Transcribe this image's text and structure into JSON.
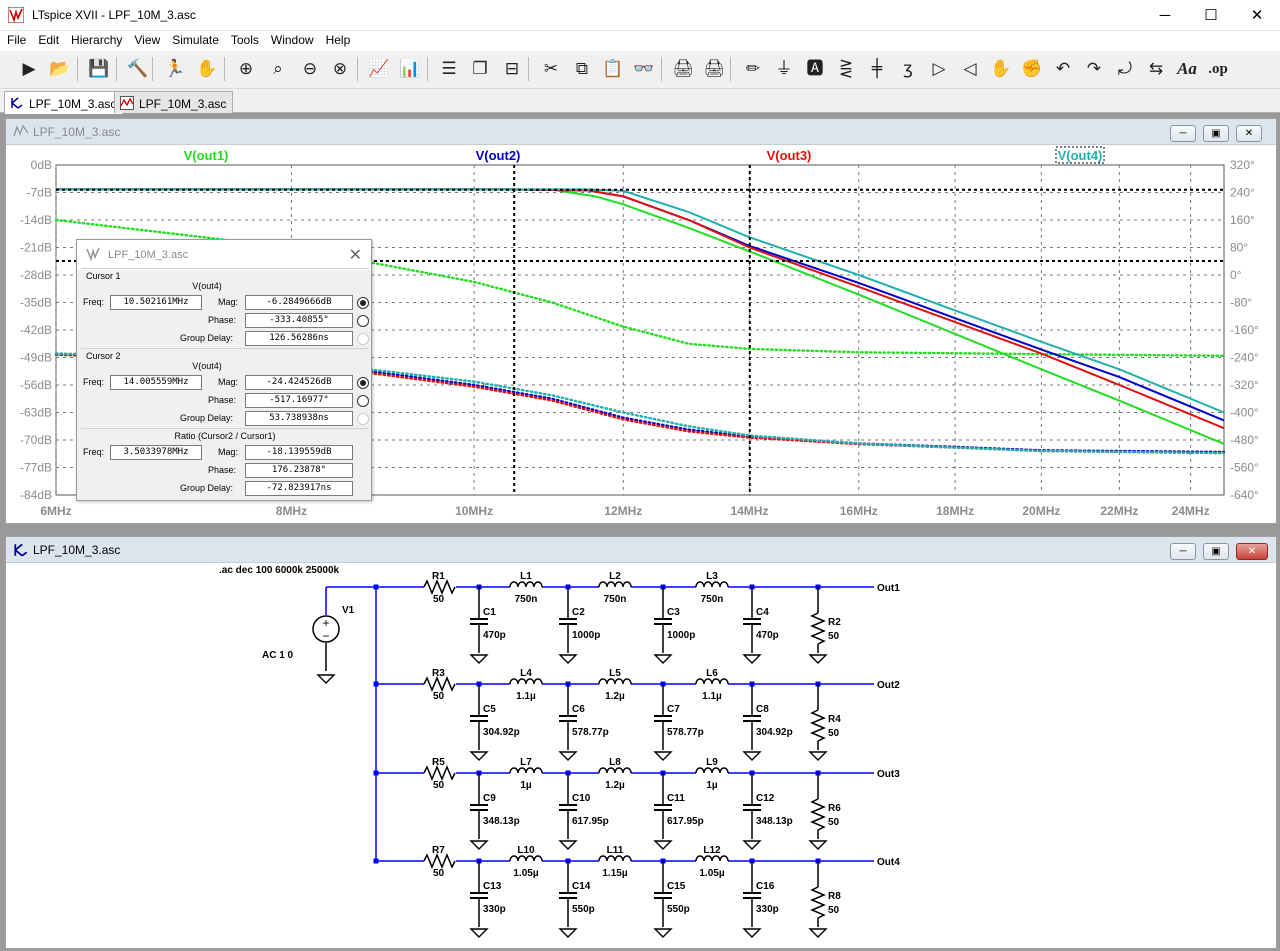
{
  "app": {
    "title": "LTspice XVII - LPF_10M_3.asc",
    "minimize": "─",
    "maximize": "☐",
    "close": "✕"
  },
  "menu": [
    "File",
    "Edit",
    "Hierarchy",
    "View",
    "Simulate",
    "Tools",
    "Window",
    "Help"
  ],
  "toolbar_icons": [
    "run-icon",
    "open-icon",
    "save-icon",
    "hammer-icon",
    "halt-icon",
    "pan-hand-icon",
    "zoom-in-icon",
    "zoom-full-icon",
    "zoom-out-icon",
    "zoom-cancel-icon",
    "autorange-icon",
    "plot-settings-icon",
    "tile-horizontal-icon",
    "cascade-icon",
    "tile-vertical-icon",
    "cut-icon",
    "copy-icon",
    "paste-icon",
    "find-icon",
    "print-preview-icon",
    "print-icon",
    "wire-icon",
    "ground-icon",
    "label-icon",
    "resistor-icon",
    "capacitor-icon",
    "inductor-icon",
    "diode-icon",
    "component-icon",
    "move-icon",
    "drag-icon",
    "undo-icon",
    "redo-icon",
    "rotate-icon",
    "mirror-icon",
    "text-icon",
    "spice-directive-icon"
  ],
  "toolbar_text": {
    "text_tool": "Aa",
    ".op": ".op"
  },
  "tabs": [
    {
      "label": "LPF_10M_3.asc"
    },
    {
      "label": "LPF_10M_3.asc"
    }
  ],
  "waveform_window": {
    "title": "LPF_10M_3.asc",
    "min": "─",
    "restore": "▣",
    "close": "✕"
  },
  "schematic_window": {
    "title": "LPF_10M_3.asc",
    "min": "─",
    "restore": "▣",
    "close": "✕"
  },
  "colors": {
    "out1": "#22dd22",
    "out2": "#0000cc",
    "out3": "#e01010",
    "out4": "#20b0b0",
    "grid": "#7a7a7a",
    "axis_text": "#8c8c8c",
    "wire": "#0000ff",
    "component": "#000000"
  },
  "chart_data": {
    "type": "line",
    "x_scale": "log",
    "xlim_mhz": [
      6,
      25
    ],
    "x_ticks": [
      "6MHz",
      "8MHz",
      "10MHz",
      "12MHz",
      "14MHz",
      "16MHz",
      "18MHz",
      "20MHz",
      "22MHz",
      "24MHz"
    ],
    "x_tick_values": [
      6,
      8,
      10,
      12,
      14,
      16,
      18,
      20,
      22,
      24
    ],
    "left_ticks": [
      "0dB",
      "-7dB",
      "-14dB",
      "-21dB",
      "-28dB",
      "-35dB",
      "-42dB",
      "-49dB",
      "-56dB",
      "-63dB",
      "-70dB",
      "-77dB",
      "-84dB"
    ],
    "ylim_db": [
      -84,
      0
    ],
    "right_ticks": [
      "320°",
      "240°",
      "160°",
      "80°",
      "0°",
      "-80°",
      "-160°",
      "-240°",
      "-320°",
      "-400°",
      "-480°",
      "-560°",
      "-640°"
    ],
    "ylim_deg": [
      -640,
      320
    ],
    "series": [
      {
        "name": "V(out1)",
        "key": "out1",
        "mag": [
          [
            6,
            -6.2
          ],
          [
            10,
            -6.2
          ],
          [
            11,
            -6.3
          ],
          [
            11.6,
            -8
          ],
          [
            12,
            -10
          ],
          [
            13,
            -16
          ],
          [
            14,
            -22
          ],
          [
            16,
            -33
          ],
          [
            18,
            -43
          ],
          [
            20,
            -52
          ],
          [
            22,
            -60
          ],
          [
            25,
            -71
          ]
        ],
        "phase": [
          [
            6,
            160
          ],
          [
            8,
            80
          ],
          [
            10,
            -20
          ],
          [
            11,
            -80
          ],
          [
            12,
            -150
          ],
          [
            13,
            -200
          ],
          [
            14,
            -215
          ],
          [
            16,
            -225
          ],
          [
            20,
            -230
          ],
          [
            25,
            -235
          ]
        ]
      },
      {
        "name": "V(out2)",
        "key": "out2",
        "mag": [
          [
            6,
            -6.2
          ],
          [
            10.5,
            -6.2
          ],
          [
            11.5,
            -6.5
          ],
          [
            12,
            -8
          ],
          [
            13,
            -14
          ],
          [
            14,
            -20.6
          ],
          [
            16,
            -30
          ],
          [
            18,
            -39
          ],
          [
            20,
            -47
          ],
          [
            22,
            -54
          ],
          [
            25,
            -65
          ]
        ],
        "phase": [
          [
            6,
            -230
          ],
          [
            8,
            -250
          ],
          [
            10,
            -320
          ],
          [
            11,
            -360
          ],
          [
            12,
            -415
          ],
          [
            13,
            -450
          ],
          [
            14,
            -470
          ],
          [
            16,
            -490
          ],
          [
            18,
            -500
          ],
          [
            20,
            -510
          ],
          [
            25,
            -515
          ]
        ]
      },
      {
        "name": "V(out3)",
        "key": "out3",
        "mag": [
          [
            6,
            -6.2
          ],
          [
            10.5,
            -6.2
          ],
          [
            11.5,
            -6.5
          ],
          [
            12,
            -8
          ],
          [
            13,
            -14
          ],
          [
            14,
            -21
          ],
          [
            16,
            -31
          ],
          [
            18,
            -40
          ],
          [
            20,
            -48
          ],
          [
            22,
            -56
          ],
          [
            25,
            -67
          ]
        ],
        "phase": [
          [
            6,
            -232
          ],
          [
            8,
            -255
          ],
          [
            10,
            -325
          ],
          [
            11,
            -365
          ],
          [
            12,
            -420
          ],
          [
            13,
            -455
          ],
          [
            14,
            -473
          ],
          [
            16,
            -492
          ],
          [
            18,
            -502
          ],
          [
            20,
            -512
          ],
          [
            25,
            -518
          ]
        ]
      },
      {
        "name": "V(out4)",
        "key": "out4",
        "mag": [
          [
            6,
            -6.2
          ],
          [
            11.5,
            -6.2
          ],
          [
            12,
            -6.6
          ],
          [
            13,
            -12
          ],
          [
            14,
            -18.4
          ],
          [
            16,
            -28
          ],
          [
            18,
            -37
          ],
          [
            20,
            -45
          ],
          [
            22,
            -52
          ],
          [
            25,
            -63
          ]
        ],
        "phase": [
          [
            6,
            -228
          ],
          [
            8,
            -248
          ],
          [
            10,
            -310
          ],
          [
            11,
            -350
          ],
          [
            12,
            -400
          ],
          [
            13,
            -440
          ],
          [
            14,
            -467
          ],
          [
            16,
            -490
          ],
          [
            18,
            -502
          ],
          [
            20,
            -512
          ],
          [
            25,
            -518
          ]
        ]
      }
    ],
    "cursor1": {
      "freq_mhz": 10.502161,
      "db": -6.2849666
    },
    "cursor2": {
      "freq_mhz": 14.005559,
      "db": -24.424526
    }
  },
  "cursor_dialog": {
    "title": "LPF_10M_3.asc",
    "cursor1": {
      "label": "Cursor 1",
      "trace": "V(out4)",
      "freq_label": "Freq:",
      "freq": "10.502161MHz",
      "mag_label": "Mag:",
      "mag": "-6.2849666dB",
      "phase_label": "Phase:",
      "phase": "-333.40855°",
      "gd_label": "Group Delay:",
      "gd": "126.56286ns"
    },
    "cursor2": {
      "label": "Cursor 2",
      "trace": "V(out4)",
      "freq_label": "Freq:",
      "freq": "14.005559MHz",
      "mag_label": "Mag:",
      "mag": "-24.424526dB",
      "phase_label": "Phase:",
      "phase": "-517.16977°",
      "gd_label": "Group Delay:",
      "gd": "53.738938ns"
    },
    "ratio": {
      "label": "Ratio (Cursor2 / Cursor1)",
      "freq_label": "Freq:",
      "freq": "3.5033978MHz",
      "mag_label": "Mag:",
      "mag": "-18.139559dB",
      "phase_label": "Phase:",
      "phase": "176.23878°",
      "gd_label": "Group Delay:",
      "gd": "-72.823917ns"
    }
  },
  "schematic": {
    "directive": ".ac dec 100 6000k 25000k",
    "source": {
      "name": "V1",
      "value": "AC 1 0"
    },
    "rows": [
      {
        "rs": [
          "R1",
          "50"
        ],
        "l": [
          [
            "L1",
            "750n"
          ],
          [
            "L2",
            "750n"
          ],
          [
            "L3",
            "750n"
          ]
        ],
        "c": [
          [
            "C1",
            "470p"
          ],
          [
            "C2",
            "1000p"
          ],
          [
            "C3",
            "1000p"
          ],
          [
            "C4",
            "470p"
          ]
        ],
        "rl": [
          "R2",
          "50"
        ],
        "out": "Out1"
      },
      {
        "rs": [
          "R3",
          "50"
        ],
        "l": [
          [
            "L4",
            "1.1µ"
          ],
          [
            "L5",
            "1.2µ"
          ],
          [
            "L6",
            "1.1µ"
          ]
        ],
        "c": [
          [
            "C5",
            "304.92p"
          ],
          [
            "C6",
            "578.77p"
          ],
          [
            "C7",
            "578.77p"
          ],
          [
            "C8",
            "304.92p"
          ]
        ],
        "rl": [
          "R4",
          "50"
        ],
        "out": "Out2"
      },
      {
        "rs": [
          "R5",
          "50"
        ],
        "l": [
          [
            "L7",
            "1µ"
          ],
          [
            "L8",
            "1.2µ"
          ],
          [
            "L9",
            "1µ"
          ]
        ],
        "c": [
          [
            "C9",
            "348.13p"
          ],
          [
            "C10",
            "617.95p"
          ],
          [
            "C11",
            "617.95p"
          ],
          [
            "C12",
            "348.13p"
          ]
        ],
        "rl": [
          "R6",
          "50"
        ],
        "out": "Out3"
      },
      {
        "rs": [
          "R7",
          "50"
        ],
        "l": [
          [
            "L10",
            "1.05µ"
          ],
          [
            "L11",
            "1.15µ"
          ],
          [
            "L12",
            "1.05µ"
          ]
        ],
        "c": [
          [
            "C13",
            "330p"
          ],
          [
            "C14",
            "550p"
          ],
          [
            "C15",
            "550p"
          ],
          [
            "C16",
            "330p"
          ]
        ],
        "rl": [
          "R8",
          "50"
        ],
        "out": "Out4"
      }
    ]
  }
}
